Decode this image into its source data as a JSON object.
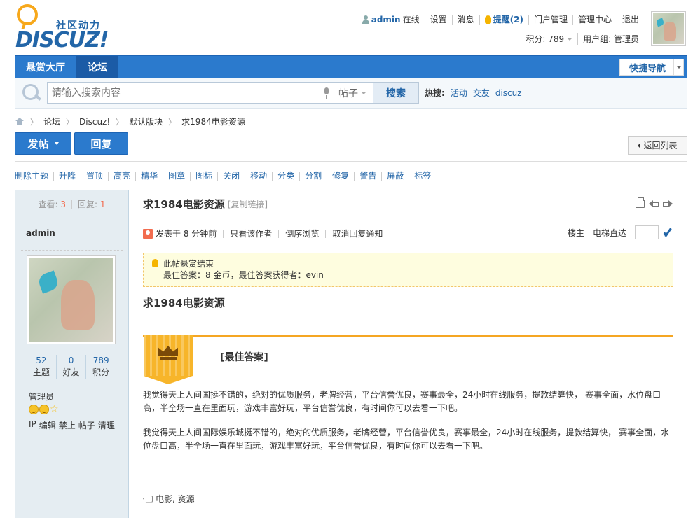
{
  "logo": {
    "sub": "社区动力",
    "main": "DISCUZ!"
  },
  "topbar": {
    "username": "admin",
    "status": "在线",
    "settings": "设置",
    "messages": "消息",
    "remind": "提醒(2)",
    "portal_admin": "门户管理",
    "admin_center": "管理中心",
    "logout": "退出"
  },
  "subbar": {
    "credits": "积分: 789",
    "usergroup": "用户组: 管理员"
  },
  "nav": {
    "items": [
      "悬赏大厅",
      "论坛"
    ],
    "quicknav": "快捷导航"
  },
  "search": {
    "placeholder": "请输入搜索内容",
    "type": "帖子",
    "button": "搜索",
    "hot_label": "热搜:",
    "hot": [
      "活动",
      "交友",
      "discuz"
    ]
  },
  "breadcrumb": {
    "items": [
      "论坛",
      "Discuz!",
      "默认版块",
      "求1984电影资源"
    ]
  },
  "buttons": {
    "post": "发帖",
    "reply": "回复",
    "back": "返回列表"
  },
  "modbar": [
    "删除主题",
    "升降",
    "置顶",
    "高亮",
    "精华",
    "图章",
    "图标",
    "关闭",
    "移动",
    "分类",
    "分割",
    "修复",
    "警告",
    "屏蔽",
    "标签"
  ],
  "thread": {
    "views_label": "查看:",
    "views": "3",
    "replies_label": "回复:",
    "replies": "1",
    "title": "求1984电影资源",
    "copy_link": "[复制链接]"
  },
  "author": {
    "name": "admin",
    "stats": [
      {
        "value": "52",
        "label": "主题"
      },
      {
        "value": "0",
        "label": "好友"
      },
      {
        "value": "789",
        "label": "积分"
      }
    ],
    "role": "管理员",
    "actions": [
      "IP",
      "编辑",
      "禁止",
      "帖子",
      "清理"
    ]
  },
  "post": {
    "posted": "发表于",
    "time": "8 分钟前",
    "links": [
      "只看该作者",
      "倒序浏览",
      "取消回复通知"
    ],
    "floor": "楼主",
    "elevator": "电梯直达",
    "notice_title": "此帖悬赏结束",
    "notice_detail": "最佳答案：8 金币，最佳答案获得者：evin",
    "body_title": "求1984电影资源",
    "best_label": "[最佳答案]",
    "para1": "我觉得天上人间国挺不错的，绝对的优质服务，老牌经营，平台信誉优良，赛事最全，24小时在线服务，提款结算快， 赛事全面，水位盘口高，半全场一直在里面玩，游戏丰富好玩，平台信誉优良，有时间你可以去看一下吧。",
    "para2": "我觉得天上人间国际娱乐城挺不错的，绝对的优质服务，老牌经营，平台信誉优良，赛事最全，24小时在线服务，提款结算快， 赛事全面，水位盘口高，半全场一直在里面玩，游戏丰富好玩，平台信誉优良，有时间你可以去看一下吧。",
    "tags": "电影, 资源"
  }
}
